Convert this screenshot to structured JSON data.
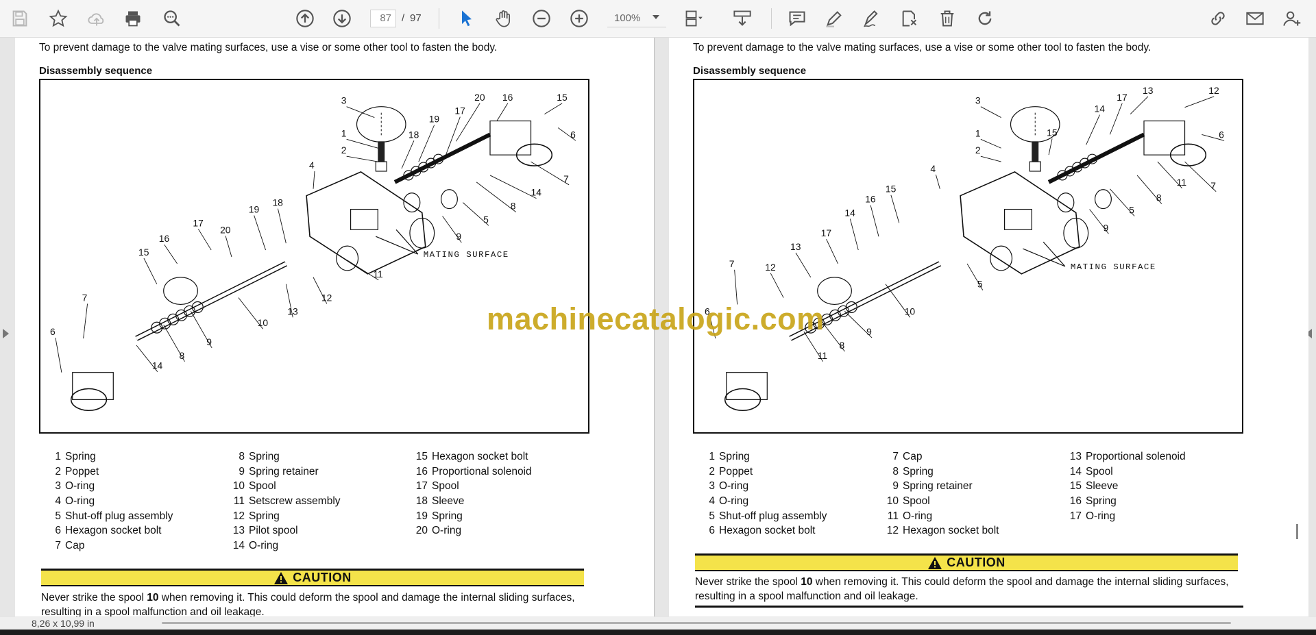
{
  "toolbar": {
    "icons": [
      "save-icon",
      "bookmark-star-icon",
      "cloud-upload-icon",
      "print-icon",
      "search-zoom-icon",
      "page-up-icon",
      "page-down-icon",
      "select-cursor-icon",
      "hand-pan-icon",
      "zoom-out-icon",
      "zoom-in-icon",
      "view-layout-icon",
      "fit-page-icon",
      "comment-icon",
      "highlight-pen-icon",
      "sign-icon",
      "stamp-icon",
      "delete-icon",
      "redo-icon",
      "share-link-icon",
      "email-icon",
      "add-user-icon"
    ],
    "current_page": "87",
    "page_separator": "/",
    "total_pages": "97",
    "zoom": "100%"
  },
  "left_page": {
    "intro": "To prevent damage to the valve mating surfaces, use a vise or some other tool to fasten the body.",
    "heading": "Disassembly sequence",
    "mating_label": "MATING SURFACE",
    "parts": [
      [
        "1",
        "Spring"
      ],
      [
        "2",
        "Poppet"
      ],
      [
        "3",
        "O-ring"
      ],
      [
        "4",
        "O-ring"
      ],
      [
        "5",
        "Shut-off plug assembly"
      ],
      [
        "6",
        "Hexagon socket bolt"
      ],
      [
        "7",
        "Cap"
      ],
      [
        "8",
        "Spring"
      ],
      [
        "9",
        "Spring retainer"
      ],
      [
        "10",
        "Spool"
      ],
      [
        "11",
        "Setscrew assembly"
      ],
      [
        "12",
        "Spring"
      ],
      [
        "13",
        "Pilot spool"
      ],
      [
        "14",
        "O-ring"
      ],
      [
        "15",
        "Hexagon socket bolt"
      ],
      [
        "16",
        "Proportional solenoid"
      ],
      [
        "17",
        "Spool"
      ],
      [
        "18",
        "Sleeve"
      ],
      [
        "19",
        "Spring"
      ],
      [
        "20",
        "O-ring"
      ]
    ],
    "caution_label": "CAUTION",
    "caution_pre": "Never strike the spool ",
    "caution_bold": "10",
    "caution_post": " when removing it. This could deform the spool and damage the internal sliding surfaces,",
    "caution_line2": "resulting in a spool malfunction and oil leakage."
  },
  "right_page": {
    "intro": "To prevent damage to the valve mating surfaces, use a vise or some other tool to fasten the body.",
    "heading": "Disassembly sequence",
    "mating_label": "MATING SURFACE",
    "parts": [
      [
        "1",
        "Spring"
      ],
      [
        "2",
        "Poppet"
      ],
      [
        "3",
        "O-ring"
      ],
      [
        "4",
        "O-ring"
      ],
      [
        "5",
        "Shut-off plug assembly"
      ],
      [
        "6",
        "Hexagon socket bolt"
      ],
      [
        "7",
        "Cap"
      ],
      [
        "8",
        "Spring"
      ],
      [
        "9",
        "Spring retainer"
      ],
      [
        "10",
        "Spool"
      ],
      [
        "11",
        "O-ring"
      ],
      [
        "12",
        "Hexagon socket bolt"
      ],
      [
        "13",
        "Proportional solenoid"
      ],
      [
        "14",
        "Spool"
      ],
      [
        "15",
        "Sleeve"
      ],
      [
        "16",
        "Spring"
      ],
      [
        "17",
        "O-ring"
      ]
    ],
    "caution_label": "CAUTION",
    "caution_pre": "Never strike the spool ",
    "caution_bold": "10",
    "caution_post": " when removing it. This could deform the spool and damage the internal sliding surfaces,",
    "caution_line2": "resulting in a spool malfunction and oil leakage."
  },
  "left_callouts": [
    "3",
    "1",
    "2",
    "18",
    "19",
    "17",
    "20",
    "16",
    "15",
    "6",
    "7",
    "4",
    "14",
    "8",
    "5",
    "9",
    "19",
    "18",
    "20",
    "17",
    "16",
    "15",
    "11",
    "12",
    "13",
    "10",
    "7",
    "6",
    "8",
    "9",
    "14"
  ],
  "right_callouts": [
    "3",
    "1",
    "2",
    "15",
    "14",
    "17",
    "13",
    "12",
    "6",
    "7",
    "4",
    "11",
    "8",
    "5",
    "9",
    "15",
    "16",
    "14",
    "17",
    "13",
    "12",
    "7",
    "10",
    "5",
    "6",
    "9",
    "8",
    "11"
  ],
  "watermark": "machinecatalogic.com",
  "status": {
    "page_size": "8,26 x 10,99 in"
  }
}
